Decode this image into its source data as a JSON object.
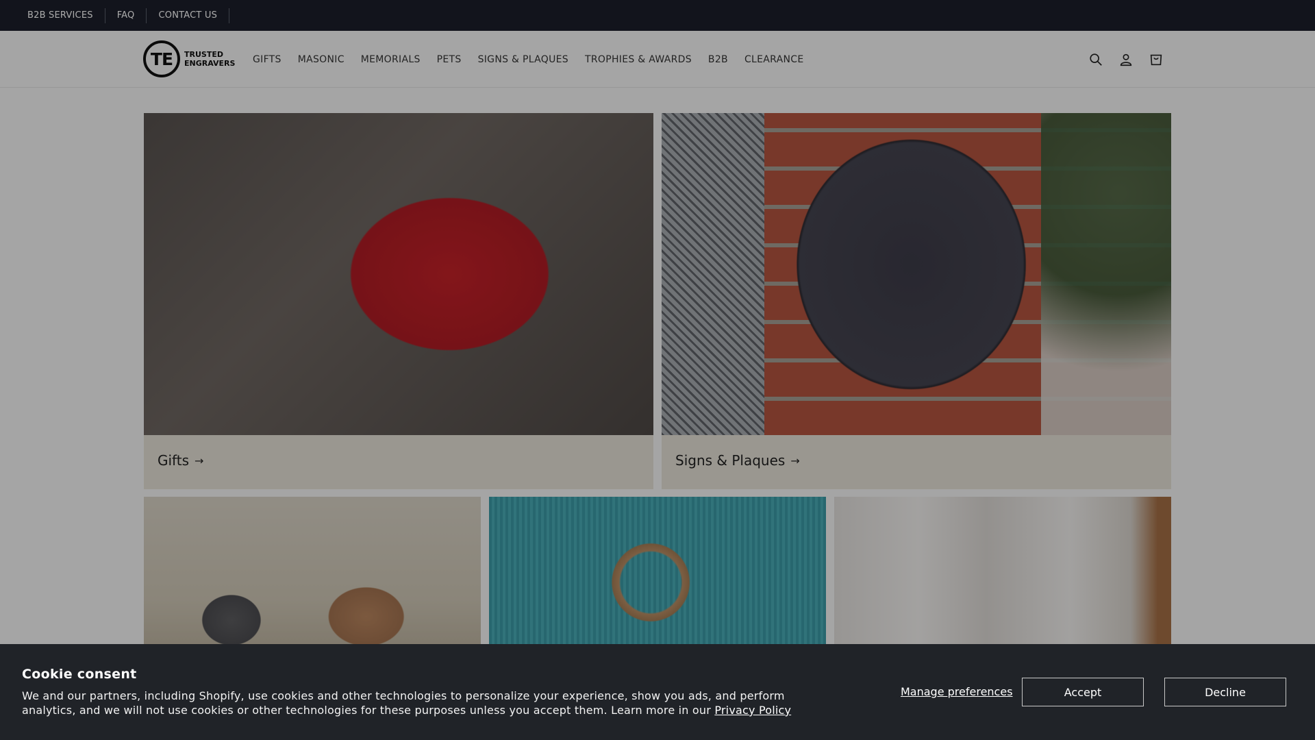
{
  "topbar": {
    "links": [
      "B2B SERVICES",
      "FAQ",
      "CONTACT US"
    ]
  },
  "header": {
    "logo": {
      "mark": "TE",
      "line1": "TRUSTED",
      "line2": "ENGRAVERS"
    },
    "nav": [
      "GIFTS",
      "MASONIC",
      "MEMORIALS",
      "PETS",
      "SIGNS & PLAQUES",
      "TROPHIES & AWARDS",
      "B2B",
      "CLEARANCE"
    ],
    "icons": [
      "search-icon",
      "account-icon",
      "cart-icon"
    ]
  },
  "collections": {
    "gifts": {
      "label": "Gifts",
      "arrow": "→"
    },
    "signs": {
      "label": "Signs & Plaques",
      "arrow": "→"
    }
  },
  "cookie": {
    "title": "Cookie consent",
    "body": "We and our partners, including Shopify, use cookies and other technologies to personalize your experience, show you ads, and perform analytics, and we will not use cookies or other technologies for these purposes unless you accept them. Learn more in our",
    "policy_link": "Privacy Policy",
    "manage": "Manage preferences",
    "accept": "Accept",
    "decline": "Decline"
  },
  "colors": {
    "topbar_bg": "#1b1f2a",
    "cookie_bg": "#202328",
    "card_caption_bg": "#e6e2d7"
  }
}
